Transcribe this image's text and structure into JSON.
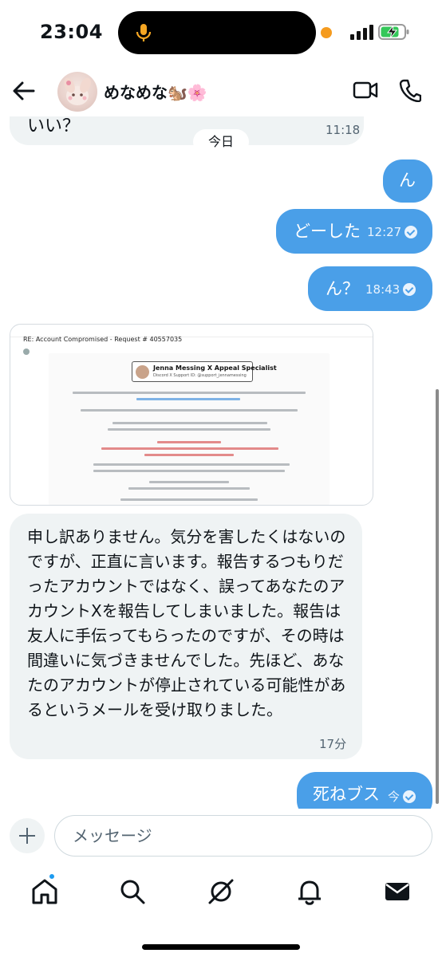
{
  "status_bar": {
    "time": "23:04"
  },
  "header": {
    "contact_name": "めなめな🐿️🌸"
  },
  "messages": {
    "date_divider": "今日",
    "top_partial": {
      "text": "いい？",
      "time": "11:18"
    },
    "sent_1": {
      "text": "ん"
    },
    "sent_2": {
      "text": "どーした",
      "time": "12:27"
    },
    "sent_3": {
      "text": "ん？",
      "time": "18:43"
    },
    "attachment": {
      "subject": "RE: Account Compromised - Request # 40557035",
      "banner_title": "Jenna Messing X Appeal Specialist",
      "banner_subtitle": "Discord X Support ID: @support_jennamessing"
    },
    "long_received": {
      "text": "申し訳ありません。気分を害したくはないのですが、正直に言います。報告するつもりだったアカウントではなく、誤ってあなたのアカウントXを報告してしまいました。報告は友人に手伝ってもらったのですが、その時は間違いに気づきませんでした。先ほど、あなたのアカウントが停止されている可能性があるというメールを受け取りました。",
      "time": "17分"
    },
    "sent_last": {
      "text": "死ねブス",
      "time": "今"
    }
  },
  "composer": {
    "placeholder": "メッセージ"
  },
  "nav": {
    "items": [
      "home-icon",
      "search-icon",
      "grok-icon",
      "notifications-icon",
      "messages-icon"
    ],
    "home_has_badge": true
  },
  "colors": {
    "sent_bubble": "#4a9fe8",
    "received_bubble": "#eff3f4",
    "accent": "#1d9bf0"
  }
}
